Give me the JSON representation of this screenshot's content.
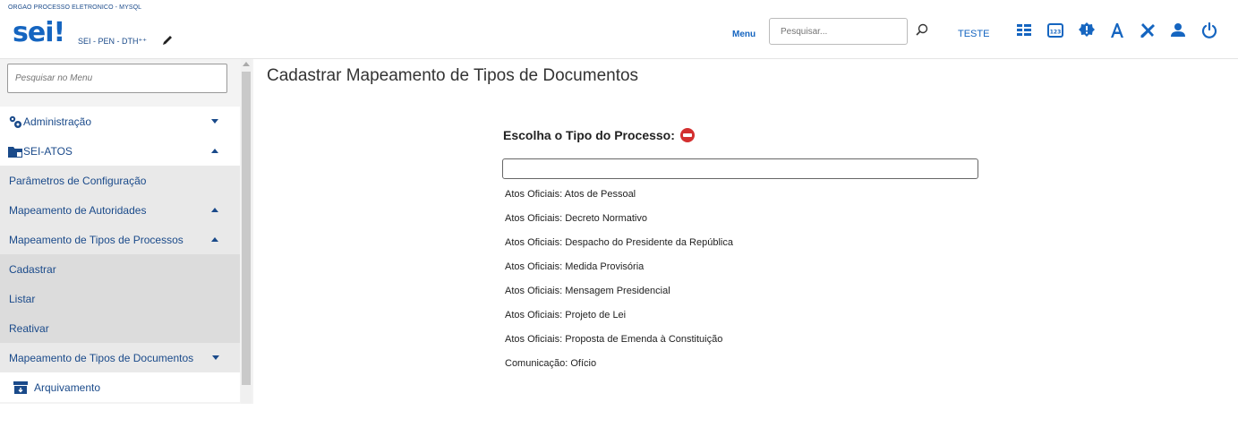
{
  "header": {
    "org": "ORGAO PROCESSO ELETRONICO - MYSQL",
    "logo_text": "sei",
    "logo_mark": "!",
    "system": "SEI - PEN - DTH⁺⁺",
    "menu_label": "Menu",
    "search_placeholder": "Pesquisar...",
    "unit": "TESTE",
    "icons": [
      "edit-pencil-icon",
      "search-icon",
      "list-icon",
      "calendar-123-icon",
      "badge-icon",
      "font-size-icon",
      "tools-icon",
      "user-icon",
      "power-icon"
    ]
  },
  "sidebar": {
    "search_placeholder": "Pesquisar no Menu",
    "items": [
      {
        "label": "Administração",
        "icon": "gears-icon",
        "caret": "down"
      },
      {
        "label": "SEI-ATOS",
        "icon": "folder-icon",
        "caret": "up"
      },
      {
        "label": "Parâmetros de Configuração"
      },
      {
        "label": "Mapeamento de Autoridades",
        "caret": "up"
      },
      {
        "label": "Mapeamento de Tipos de Processos",
        "caret": "up"
      },
      {
        "label": "Cadastrar"
      },
      {
        "label": "Listar"
      },
      {
        "label": "Reativar"
      },
      {
        "label": "Mapeamento de Tipos de Documentos",
        "caret": "down"
      },
      {
        "label": "Arquivamento",
        "icon": "archive-icon"
      }
    ]
  },
  "main": {
    "title": "Cadastrar Mapeamento de Tipos de Documentos",
    "field_label": "Escolha o Tipo do Processo:",
    "options": [
      "Atos Oficiais: Atos de Pessoal",
      "Atos Oficiais: Decreto Normativo",
      "Atos Oficiais: Despacho do Presidente da República",
      "Atos Oficiais: Medida Provisória",
      "Atos Oficiais: Mensagem Presidencial",
      "Atos Oficiais: Projeto de Lei",
      "Atos Oficiais: Proposta de Emenda à Constituição",
      "Comunicação: Ofício"
    ]
  },
  "colors": {
    "brand_blue": "#1565c0",
    "link_blue": "#1a4a8a",
    "remove_red": "#d32f2f"
  }
}
